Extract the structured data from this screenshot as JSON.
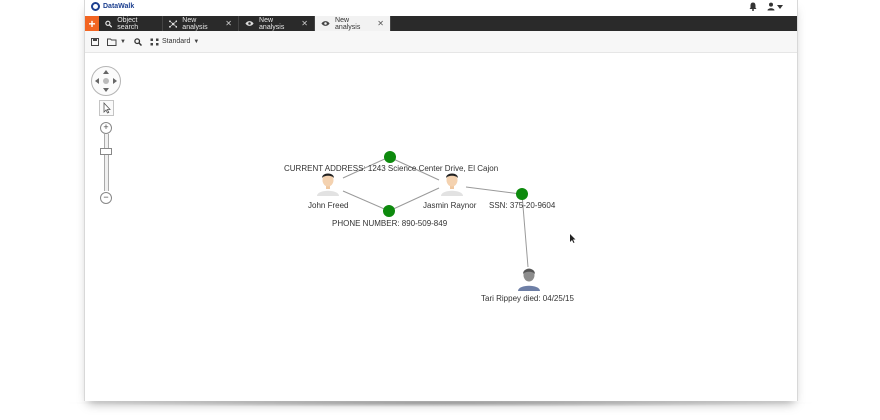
{
  "app": {
    "name": "DataWalk"
  },
  "tabs": [
    {
      "label": "Object search"
    },
    {
      "label": "New analysis"
    },
    {
      "label": "New analysis"
    },
    {
      "label": "New analysis"
    }
  ],
  "toolbar": {
    "layout_label": "Standard"
  },
  "graph": {
    "attributes": {
      "address": "CURRENT ADDRESS: 1243 Science Center Drive, El Cajon",
      "phone": "PHONE NUMBER: 890-509-849",
      "ssn": "SSN: 375-20-9604"
    },
    "people": {
      "john": "John Freed",
      "jasmin": "Jasmin Raynor",
      "tari": "Tari Rippey died: 04/25/15"
    }
  },
  "colors": {
    "accent": "#f26522",
    "attribute_node": "#0d8a0d",
    "tabbar": "#2a2a2a",
    "brand": "#1c3f8f"
  },
  "icons": [
    "bell-icon",
    "user-icon",
    "search-icon",
    "network-icon",
    "eye-icon",
    "close-icon",
    "save-icon",
    "folder-icon",
    "layout-icon",
    "pan-icon",
    "select-icon",
    "zoom-in-icon",
    "zoom-out-icon"
  ]
}
